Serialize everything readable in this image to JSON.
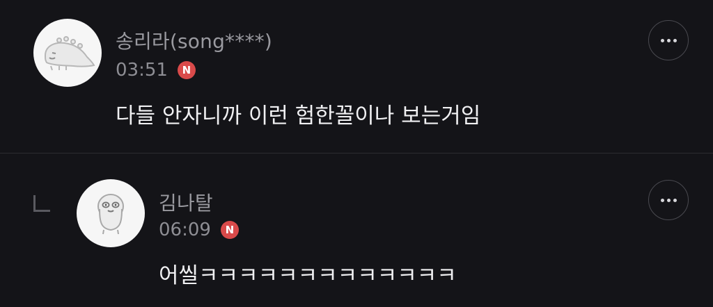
{
  "comments": [
    {
      "author": "송리라(song****)",
      "time": "03:51",
      "badge": "N",
      "text": "다들 안자니까 이런 험한꼴이나 보는거임",
      "avatar_icon": "dinosaur-avatar-icon",
      "more_icon": "more-options-icon"
    },
    {
      "author": "김나탈",
      "time": "06:09",
      "badge": "N",
      "text": "어씰ㅋㅋㅋㅋㅋㅋㅋㅋㅋㅋㅋㅋㅋ",
      "avatar_icon": "character-avatar-icon",
      "more_icon": "more-options-icon",
      "is_reply": true
    }
  ],
  "colors": {
    "background": "#141418",
    "badge": "#d94a4a",
    "name": "#9a9aa0",
    "text": "#f0f0f2"
  }
}
